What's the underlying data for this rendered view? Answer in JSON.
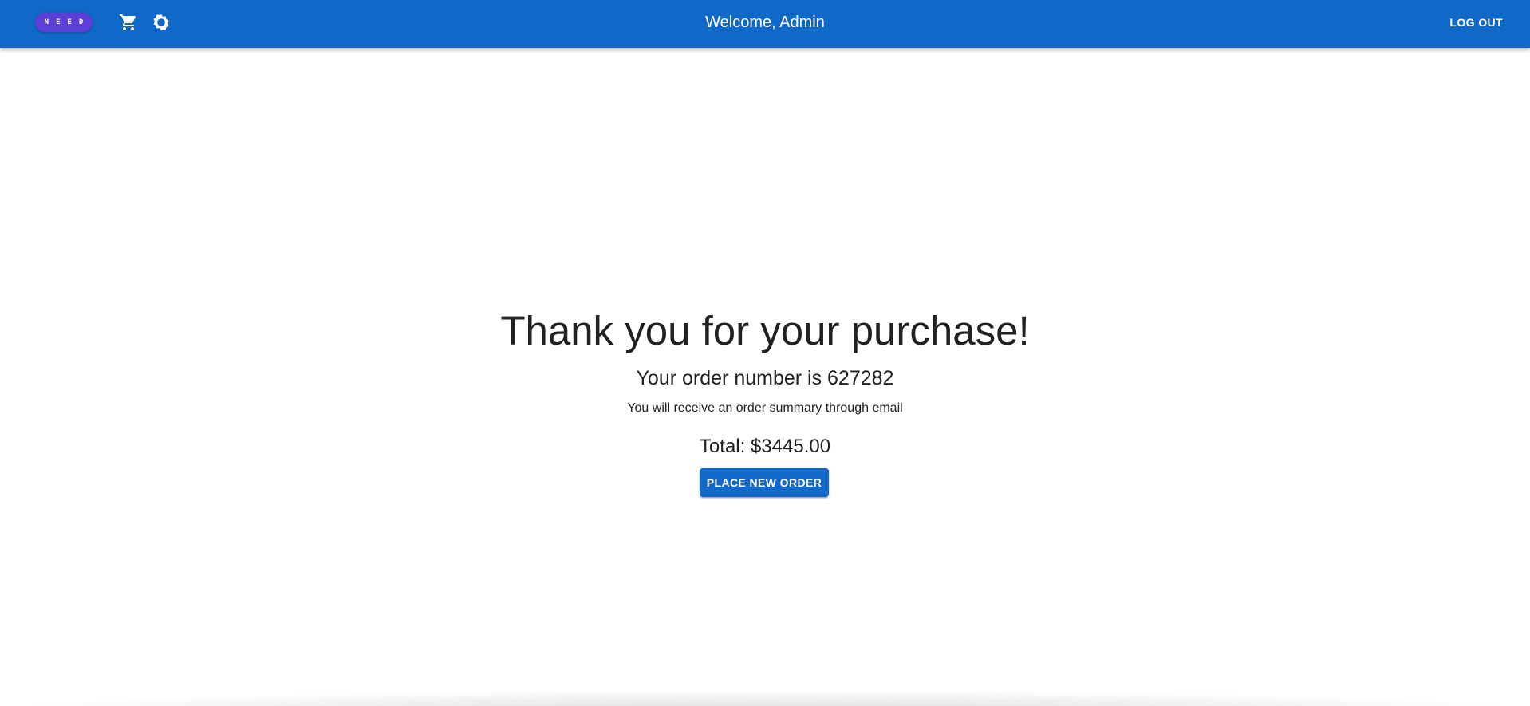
{
  "appbar": {
    "logo_letters": [
      "N",
      "E",
      "E",
      "D"
    ],
    "logo_color": "#5b3fd6",
    "background_color": "#1068c8",
    "cart_icon": "shopping-cart-icon",
    "settings_icon": "gear-icon",
    "welcome_text": "Welcome, Admin",
    "logout_label": "LOG OUT"
  },
  "confirmation": {
    "headline": "Thank you for your purchase!",
    "order_number_text": "Your order number is 627282",
    "email_note": "You will receive an order summary through email",
    "total_text": "Total: $3445.00",
    "place_new_order_label": "PLACE NEW ORDER"
  }
}
